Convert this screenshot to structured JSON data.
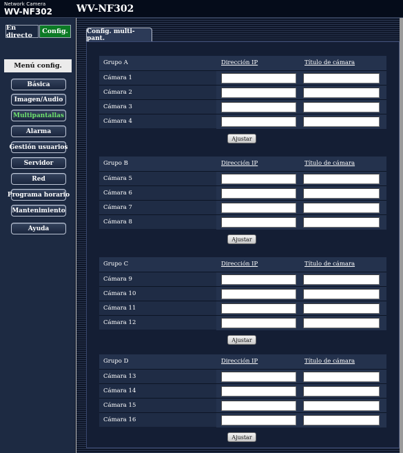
{
  "brand": {
    "small": "Network Camera",
    "model": "WV-NF302"
  },
  "header": {
    "title": "WV-NF302"
  },
  "modes": {
    "live": "En directo",
    "config": "Config."
  },
  "menu": {
    "title": "Menú config.",
    "items": [
      {
        "label": "Básica"
      },
      {
        "label": "Imagen/Audio"
      },
      {
        "label": "Multipantallas",
        "active": true
      },
      {
        "label": "Alarma"
      },
      {
        "label": "Gestión usuarios"
      },
      {
        "label": "Servidor"
      },
      {
        "label": "Red"
      },
      {
        "label": "Programa horario"
      },
      {
        "label": "Mantenimiento"
      },
      {
        "label": "Ayuda"
      }
    ]
  },
  "tab": {
    "label": "Config. multi-pant."
  },
  "columns": {
    "ip": "Dirección IP",
    "title": "Título de cámara"
  },
  "adjust_label": "Ajustar",
  "groups": [
    {
      "name": "Grupo A",
      "cameras": [
        {
          "label": "Cámara 1",
          "ip": "",
          "title": ""
        },
        {
          "label": "Cámara 2",
          "ip": "",
          "title": ""
        },
        {
          "label": "Cámara 3",
          "ip": "",
          "title": ""
        },
        {
          "label": "Cámara 4",
          "ip": "",
          "title": ""
        }
      ]
    },
    {
      "name": "Grupo B",
      "cameras": [
        {
          "label": "Cámara 5",
          "ip": "",
          "title": ""
        },
        {
          "label": "Cámara 6",
          "ip": "",
          "title": ""
        },
        {
          "label": "Cámara 7",
          "ip": "",
          "title": ""
        },
        {
          "label": "Cámara 8",
          "ip": "",
          "title": ""
        }
      ]
    },
    {
      "name": "Grupo C",
      "cameras": [
        {
          "label": "Cámara 9",
          "ip": "",
          "title": ""
        },
        {
          "label": "Cámara 10",
          "ip": "",
          "title": ""
        },
        {
          "label": "Cámara 11",
          "ip": "",
          "title": ""
        },
        {
          "label": "Cámara 12",
          "ip": "",
          "title": ""
        }
      ]
    },
    {
      "name": "Grupo D",
      "cameras": [
        {
          "label": "Cámara 13",
          "ip": "",
          "title": ""
        },
        {
          "label": "Cámara 14",
          "ip": "",
          "title": ""
        },
        {
          "label": "Cámara 15",
          "ip": "",
          "title": ""
        },
        {
          "label": "Cámara 16",
          "ip": "",
          "title": ""
        }
      ]
    }
  ],
  "colors": {
    "active_menu": "#6fe36f",
    "config_mode": "#0c7a25"
  }
}
